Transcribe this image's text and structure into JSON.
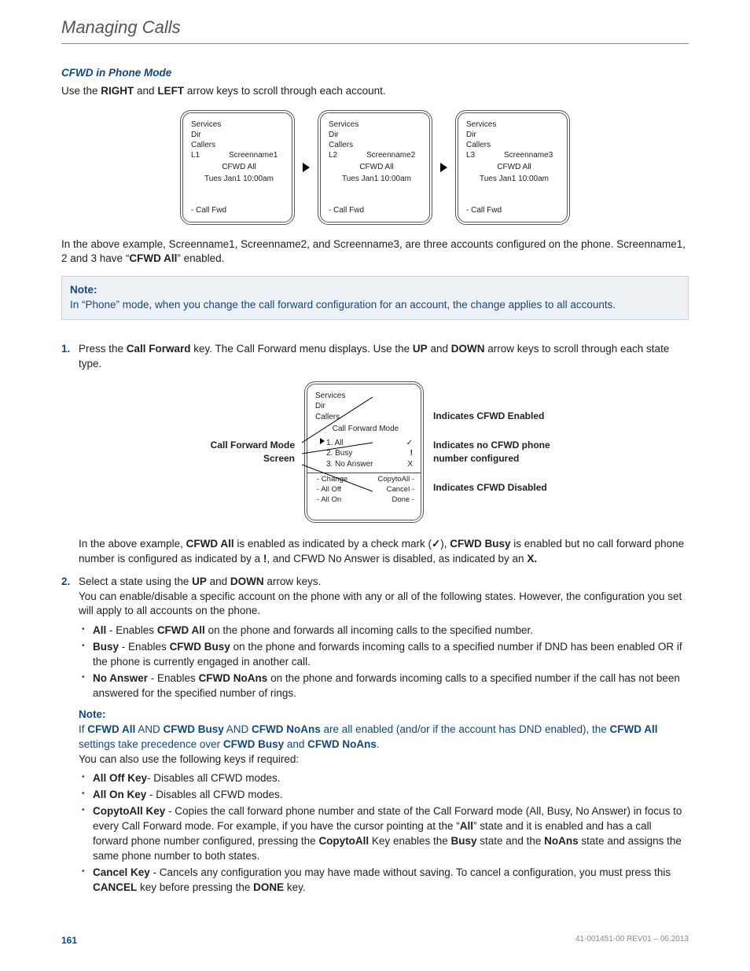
{
  "header": {
    "title": "Managing Calls"
  },
  "section": {
    "subheading": "CFWD in Phone Mode",
    "intro_pre": "Use the ",
    "intro_k1": "RIGHT",
    "intro_mid": " and ",
    "intro_k2": "LEFT",
    "intro_post": " arrow keys to scroll through each account."
  },
  "phones_top": [
    {
      "line": "L1",
      "screen": "Screenname1"
    },
    {
      "line": "L2",
      "screen": "Screenname2"
    },
    {
      "line": "L3",
      "screen": "Screenname3"
    }
  ],
  "phone_common": {
    "r1": "Services",
    "r2": "Dir",
    "r3": "Callers",
    "cfwd": "CFWD All",
    "date": "Tues Jan1 10:00am",
    "foot": "- Call Fwd"
  },
  "para_mid_a": "In the above example, Screenname1, Screenname2, and Screenname3, are three accounts configured on the phone. Screenname1, 2 and 3 have “",
  "para_mid_b": "CFWD All",
  "para_mid_c": "” enabled.",
  "note1": {
    "title": "Note:",
    "body": "In “Phone” mode, when you change the call forward configuration for an account, the change applies to all accounts."
  },
  "step1": {
    "a": "Press the ",
    "b": "Call Forward",
    "c": " key. The Call Forward menu displays. Use the ",
    "d": "UP",
    "e": " and ",
    "f": "DOWN",
    "g": " arrow keys to scroll through each state type."
  },
  "diag2_left": "Call Forward Mode Screen",
  "phone2": {
    "r1": "Services",
    "r2": "Dir",
    "r3": "Callers",
    "title": "Call Forward Mode",
    "opt1": "1. All",
    "m1": "✓",
    "opt2": "2. Busy",
    "m2": "!",
    "opt3": "3. No Answer",
    "m3": "X",
    "skL1": "- Change",
    "skL2": "- All Off",
    "skL3": "- All On",
    "skR1": "CopytoAll -",
    "skR2": "Cancel -",
    "skR3": "Done -"
  },
  "ind": {
    "a": "Indicates CFWD Enabled",
    "b": "Indicates no CFWD phone number configured",
    "c": "Indicates CFWD Disabled"
  },
  "step1_after": {
    "a": "In the above example, ",
    "b": "CFWD All",
    "c": " is enabled as indicated by a check mark (",
    "d": "✓",
    "e": "), ",
    "f": "CFWD Busy",
    "g": " is enabled but no call forward phone number is configured as indicated by a ",
    "h": "!",
    "i": ", and CFWD No Answer is disabled, as indicated by an ",
    "j": "X."
  },
  "step2": {
    "a": "Select a state using the ",
    "b": "UP",
    "c": " and ",
    "d": "DOWN",
    "e": " arrow keys.",
    "f": "You can enable/disable a specific account on the phone with any or all of the following states. However, the configuration you set will apply to all accounts on the phone."
  },
  "bullets1": {
    "all_a": "All",
    "all_b": " - Enables ",
    "all_c": "CFWD All",
    "all_d": " on the phone and forwards all incoming calls to the specified number.",
    "busy_a": "Busy",
    "busy_b": " - Enables ",
    "busy_c": "CFWD Busy",
    "busy_d": " on the phone and forwards incoming calls to a specified number if DND has been enabled OR if the phone is currently engaged in another call.",
    "na_a": "No Answer",
    "na_b": " - Enables ",
    "na_c": "CFWD NoAns",
    "na_d": " on the phone and forwards incoming calls to a specified number if the call has not been answered for the specified number of rings."
  },
  "note2": {
    "title": "Note:",
    "a": "If ",
    "b": "CFWD All",
    "c": " AND ",
    "d": "CFWD Busy",
    "e": " AND ",
    "f": "CFWD NoAns",
    "g": " are all enabled (and/or if the account has DND enabled), the ",
    "h": "CFWD All",
    "i": " settings take precedence over ",
    "j": "CFWD Busy",
    "k": " and ",
    "l": "CFWD NoAns",
    "m": "."
  },
  "after_note": "You can also use the following keys if required:",
  "bullets2": {
    "off_a": "All Off Key",
    "off_b": "- Disables all CFWD modes.",
    "on_a": "All On Key",
    "on_b": " - Disables all CFWD modes.",
    "cp_a": "CopytoAll Key",
    "cp_b": " - Copies the call forward phone number and state of the Call Forward mode (All, Busy, No Answer) in focus to every Call Forward mode. For example, if you have the cursor pointing at the “",
    "cp_c": "All",
    "cp_d": "” state and it is enabled and has a call forward phone number configured, pressing the ",
    "cp_e": "CopytoAll",
    "cp_f": " Key enables the ",
    "cp_g": "Busy",
    "cp_h": " state and the ",
    "cp_i": "NoAns",
    "cp_j": " state and assigns the same phone number to both states.",
    "cn_a": "Cancel Key",
    "cn_b": " - Cancels any configuration you may have made without saving. To cancel a configuration, you must press this ",
    "cn_c": "CANCEL",
    "cn_d": " key before pressing the ",
    "cn_e": "DONE",
    "cn_f": " key."
  },
  "footer": {
    "page": "161",
    "docid": "41-001451-00 REV01 – 06.2013"
  }
}
